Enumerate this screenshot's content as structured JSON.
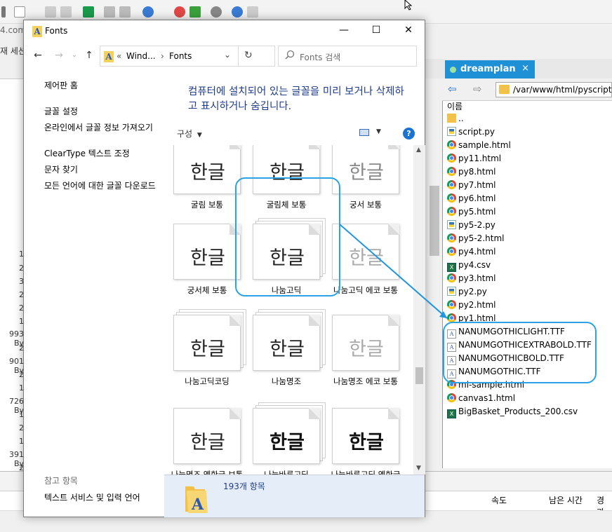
{
  "background_app": {
    "url_fragment": "4.com",
    "session_fragment": "재 세션",
    "left_numbers": [
      "1",
      "2",
      "3",
      "2",
      "2",
      "1",
      "993 By",
      "2",
      "901 By",
      "2",
      "1",
      "726 By",
      "1",
      "2",
      "1",
      "391 By",
      "2"
    ],
    "status_columns": [
      "속도",
      "남은 시간",
      "경과"
    ]
  },
  "right_pane": {
    "tab_label": "dreamplan",
    "tab_close": "×",
    "path": "/var/www/html/pyscript",
    "column_header": "이름",
    "files": [
      {
        "name": "..",
        "icon": "folder-icon"
      },
      {
        "name": "script.py",
        "icon": "python-file-icon"
      },
      {
        "name": "sample.html",
        "icon": "chrome-icon"
      },
      {
        "name": "py11.html",
        "icon": "chrome-icon"
      },
      {
        "name": "py8.html",
        "icon": "chrome-icon"
      },
      {
        "name": "py7.html",
        "icon": "chrome-icon"
      },
      {
        "name": "py6.html",
        "icon": "chrome-icon"
      },
      {
        "name": "py5.html",
        "icon": "chrome-icon"
      },
      {
        "name": "py5-2.py",
        "icon": "python-file-icon"
      },
      {
        "name": "py5-2.html",
        "icon": "chrome-icon"
      },
      {
        "name": "py4.html",
        "icon": "chrome-icon"
      },
      {
        "name": "py4.csv",
        "icon": "excel-icon"
      },
      {
        "name": "py3.html",
        "icon": "chrome-icon"
      },
      {
        "name": "py2.py",
        "icon": "python-file-icon"
      },
      {
        "name": "py2.html",
        "icon": "chrome-icon"
      },
      {
        "name": "py1.html",
        "icon": "chrome-icon"
      },
      {
        "name": "NANUMGOTHICLIGHT.TTF",
        "icon": "font-file-icon"
      },
      {
        "name": "NANUMGOTHICEXTRABOLD.TTF",
        "icon": "font-file-icon"
      },
      {
        "name": "NANUMGOTHICBOLD.TTF",
        "icon": "font-file-icon"
      },
      {
        "name": "NANUMGOTHIC.TTF",
        "icon": "font-file-icon"
      },
      {
        "name": "ml-sample.html",
        "icon": "chrome-icon"
      },
      {
        "name": "canvas1.html",
        "icon": "chrome-icon"
      },
      {
        "name": "BigBasket_Products_200.csv",
        "icon": "excel-icon"
      }
    ]
  },
  "fonts_window": {
    "title": "Fonts",
    "controls": {
      "minimize": "—",
      "maximize": "☐",
      "close": "✕"
    },
    "nav": {
      "back": "←",
      "forward": "→",
      "up": "↑",
      "refresh": "↻"
    },
    "address": {
      "prefix": "«",
      "crumb1": "Wind...",
      "sep": "›",
      "crumb2": "Fonts",
      "dropdown": "⌄"
    },
    "search_placeholder": "Fonts 검색",
    "left_nav": {
      "home": "제어판 홈",
      "links": [
        "글꼴 설정",
        "온라인에서 글꼴 정보 가져오기",
        "ClearType 텍스트 조정",
        "문자 찾기",
        "모든 언어에 대한 글꼴 다운로드"
      ],
      "see_also_heading": "참고 항목",
      "see_also": [
        "텍스트 서비스 및 입력 언어"
      ]
    },
    "description": "컴퓨터에 설치되어 있는 글꼴을 미리 보거나 삭제하고 표시하거나 숨깁니다.",
    "organize_label": "구성",
    "help": "?",
    "sample_text": "한글",
    "fonts": [
      {
        "name": "굴림 보통",
        "stack": false,
        "style": "plain"
      },
      {
        "name": "굴림체 보통",
        "stack": false,
        "style": "plain"
      },
      {
        "name": "궁서 보통",
        "stack": false,
        "style": "light"
      },
      {
        "name": "궁서체 보통",
        "stack": false,
        "style": "plain"
      },
      {
        "name": "나눔고딕",
        "stack": true,
        "style": "plain"
      },
      {
        "name": "나눔고딕 에코 보통",
        "stack": false,
        "style": "eco"
      },
      {
        "name": "나눔고딕코딩",
        "stack": true,
        "style": "plain"
      },
      {
        "name": "나눔명조",
        "stack": true,
        "style": "serif"
      },
      {
        "name": "나눔명조 에코 보통",
        "stack": false,
        "style": "eco"
      },
      {
        "name": "나눔명조 옛한글 보통",
        "stack": false,
        "style": "plain"
      },
      {
        "name": "나눔바른고딕",
        "stack": true,
        "style": "bold"
      },
      {
        "name": "나눔바른고딕 옛한글 보통",
        "stack": false,
        "style": "bold"
      }
    ],
    "status_count": "193개 항목"
  }
}
